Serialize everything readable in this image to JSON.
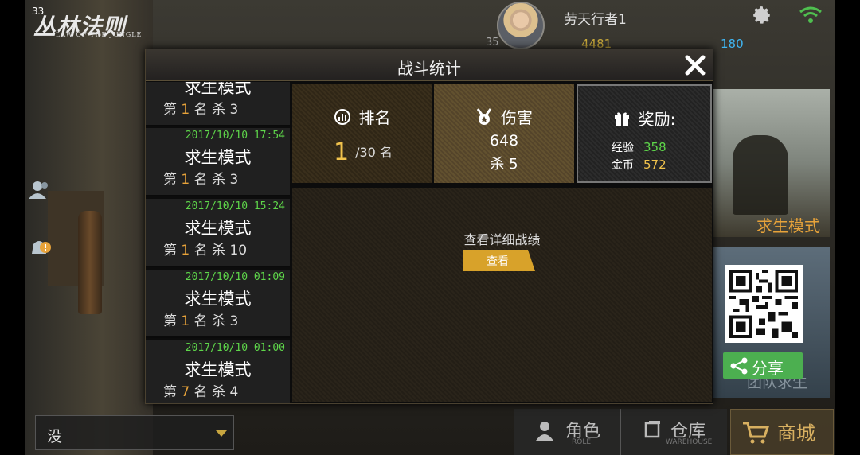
{
  "status_bar": {
    "number": "33"
  },
  "logo": {
    "cn": "丛林法则",
    "en": "LAW OF THE JUNGLE"
  },
  "header": {
    "player_name": "劳天行者1",
    "res_left": "35",
    "gold": "4481",
    "diamond": "180"
  },
  "right_panel": {
    "mode_label": "求生模式",
    "mode_label_2": "团队求生",
    "share_label": "分享"
  },
  "dialog": {
    "title": "战斗统计",
    "matches": [
      {
        "timestamp": "",
        "mode": "求生模式",
        "result_prefix": "第 ",
        "rank": "1",
        "result_suffix": " 名 杀 3"
      },
      {
        "timestamp": "2017/10/10 17:54",
        "mode": "求生模式",
        "result_prefix": "第 ",
        "rank": "1",
        "result_suffix": " 名 杀 3"
      },
      {
        "timestamp": "2017/10/10 15:24",
        "mode": "求生模式",
        "result_prefix": "第 ",
        "rank": "1",
        "result_suffix": " 名 杀 10"
      },
      {
        "timestamp": "2017/10/10 01:09",
        "mode": "求生模式",
        "result_prefix": "第 ",
        "rank": "1",
        "result_suffix": " 名 杀 3"
      },
      {
        "timestamp": "2017/10/10 01:00",
        "mode": "求生模式",
        "result_prefix": "第 ",
        "rank": "7",
        "result_suffix": " 名 杀 4"
      }
    ],
    "rank_card": {
      "title": "排名",
      "rank": "1",
      "total": "/30 名"
    },
    "damage_card": {
      "title": "伤害",
      "damage": "648",
      "kills": "杀 5"
    },
    "reward_card": {
      "title": "奖励:",
      "exp_label": "经验",
      "exp_value": "358",
      "exp_color": "#5ed64a",
      "coin_label": "金币",
      "coin_value": "572",
      "coin_color": "#f0c24c"
    },
    "detail": {
      "label": "查看详细战绩",
      "button": "查看"
    }
  },
  "bottom_bar": {
    "select_value": "没",
    "role_label": "角色",
    "role_sub": "ROLE",
    "warehouse_label": "仓库",
    "warehouse_sub": "WAREHOUSE",
    "shop_label": "商城"
  },
  "colors": {
    "accent": "#d8a22a",
    "green": "#4caf50",
    "timestamp": "#5ed64a"
  },
  "icons": [
    "gear-icon",
    "wifi-icon",
    "contacts-icon",
    "alert-icon",
    "close-icon",
    "rank-icon",
    "medal-icon",
    "gift-icon",
    "share-icon",
    "cart-icon",
    "role-icon",
    "warehouse-icon",
    "chevron-down-icon"
  ]
}
